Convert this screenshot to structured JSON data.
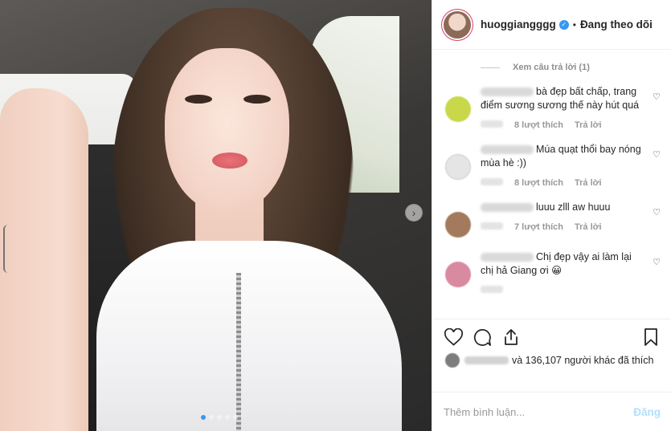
{
  "post": {
    "image_alt": "",
    "carousel": {
      "total": 5,
      "active": 1
    }
  },
  "header": {
    "username": "huoggiangggg",
    "verified": true,
    "separator": "•",
    "follow_status": "Đang theo dõi"
  },
  "view_replies": "Xem câu trả lời (1)",
  "comments": [
    {
      "text": "bà đẹp bất chấp, trang điểm sương sương thế này hút quá",
      "likes": "8 lượt thích",
      "reply": "Trả lời",
      "avatar_color": "#c8d84a"
    },
    {
      "text": "Múa quạt thổi bay nóng mùa hè :))",
      "likes": "8 lượt thích",
      "reply": "Trả lời",
      "avatar_color": "#e5e5e5"
    },
    {
      "text": "luuu zlll aw huuu",
      "likes": "7 lượt thích",
      "reply": "Trả lời",
      "avatar_color": "#a47a5c"
    },
    {
      "text": "Chị đẹp vậy ai làm lại chị hả Giang ơi 😀",
      "likes": "",
      "reply": "",
      "avatar_color": "#d88aa0"
    }
  ],
  "likes_text": "và 136,107 người khác đã thích",
  "add_comment": {
    "placeholder": "Thêm bình luận...",
    "post_label": "Đăng"
  },
  "icons": [
    "heart-icon",
    "comment-icon",
    "share-icon",
    "bookmark-icon",
    "chevron-right-icon",
    "verified-icon"
  ],
  "colors": {
    "accent_blue": "#3897f0",
    "post_button_disabled": "#b2dffc",
    "muted_text": "#8e8e8e"
  }
}
